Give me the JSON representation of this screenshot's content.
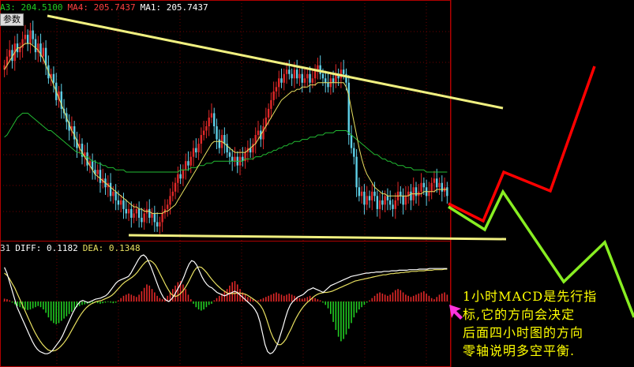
{
  "colors": {
    "background": "#000000",
    "frame": "#b00000",
    "grid": "#6e0000",
    "up_candle": "#e02828",
    "down_candle": "#5fd0e8",
    "ma_short": "#e8e060",
    "ma_long": "#22bb33",
    "trendline": "#f0f080",
    "diff_line": "#ffffff",
    "dea_line": "#e8e060",
    "macd_up": "#e02828",
    "macd_down": "#22cc22",
    "forecast_red": "#ff0000",
    "forecast_green": "#88ee22",
    "annotation_text": "#ffff00",
    "arrow": "#ff33dd"
  },
  "legend_top": [
    {
      "text": "A3: 204.5100",
      "color": "#22cc22"
    },
    {
      "text": "MA4: 205.7437",
      "color": "#ff4040"
    },
    {
      "text": "MA1: 205.7437",
      "color": "#ffffff"
    }
  ],
  "param_tag": "参数",
  "legend_bottom": [
    {
      "text": "31",
      "color": "#dddddd"
    },
    {
      "text": "DIFF: 0.1182",
      "color": "#ffffff"
    },
    {
      "text": "DEA: 0.1348",
      "color": "#e8e060"
    }
  ],
  "annotation": {
    "lines": [
      "1小时MACD是先行指",
      "标,它的方向会决定",
      "后面四小时图的方向",
      "零轴说明多空平衡."
    ]
  },
  "chart_data": {
    "type": "candlestick",
    "price": {
      "ylim": [
        0,
        100
      ],
      "closes": [
        78,
        82,
        85,
        80,
        88,
        84,
        86,
        90,
        92,
        88,
        94,
        90,
        84,
        88,
        82,
        86,
        78,
        72,
        74,
        70,
        62,
        66,
        58,
        56,
        52,
        48,
        50,
        44,
        40,
        42,
        36,
        38,
        32,
        34,
        30,
        28,
        30,
        24,
        26,
        22,
        24,
        18,
        20,
        16,
        14,
        16,
        12,
        10,
        12,
        8,
        10,
        12,
        8,
        6,
        10,
        12,
        8,
        10,
        6,
        4,
        6,
        10,
        12,
        14,
        18,
        20,
        24,
        28,
        26,
        30,
        34,
        32,
        36,
        40,
        38,
        42,
        46,
        48,
        50,
        54,
        56,
        50,
        44,
        40,
        46,
        42,
        38,
        36,
        34,
        36,
        32,
        36,
        34,
        38,
        40,
        38,
        42,
        46,
        48,
        44,
        50,
        54,
        58,
        62,
        66,
        68,
        72,
        70,
        74,
        76,
        74,
        72,
        76,
        72,
        74,
        70,
        72,
        74,
        70,
        72,
        76,
        78,
        74,
        72,
        70,
        68,
        72,
        70,
        74,
        72,
        76,
        74,
        70,
        46,
        40,
        36,
        22,
        18,
        20,
        14,
        18,
        16,
        20,
        18,
        12,
        16,
        14,
        18,
        16,
        14,
        12,
        16,
        20,
        18,
        14,
        18,
        20,
        16,
        22,
        18,
        20,
        24,
        22,
        18,
        20,
        24,
        26,
        22,
        24,
        20,
        22,
        18
      ],
      "ma_short": [
        76,
        78,
        80,
        82,
        84,
        86,
        86,
        87,
        88,
        88,
        88,
        87,
        86,
        85,
        83,
        81,
        78,
        75,
        72,
        69,
        66,
        63,
        60,
        57,
        54,
        51,
        48,
        46,
        43,
        40,
        38,
        36,
        34,
        32,
        30,
        28,
        27,
        26,
        25,
        24,
        23,
        22,
        21,
        20,
        19,
        18,
        17,
        16,
        15,
        14,
        13,
        13,
        12,
        12,
        11,
        11,
        11,
        10,
        10,
        10,
        10,
        10,
        11,
        11,
        12,
        13,
        14,
        16,
        18,
        20,
        22,
        24,
        26,
        28,
        30,
        32,
        34,
        36,
        38,
        40,
        42,
        43,
        43,
        43,
        43,
        42,
        41,
        40,
        39,
        38,
        38,
        38,
        38,
        38,
        39,
        40,
        41,
        42,
        44,
        46,
        48,
        50,
        52,
        54,
        56,
        58,
        60,
        62,
        63,
        64,
        65,
        66,
        66,
        67,
        67,
        68,
        68,
        68,
        69,
        69,
        69,
        70,
        70,
        70,
        70,
        70,
        70,
        70,
        70,
        70,
        70,
        70,
        68,
        64,
        58,
        52,
        46,
        40,
        35,
        31,
        28,
        26,
        24,
        22,
        21,
        20,
        19,
        19,
        18,
        18,
        18,
        18,
        18,
        18,
        18,
        18,
        18,
        19,
        19,
        19,
        19,
        19,
        20,
        20,
        20,
        20,
        20,
        21,
        21,
        21,
        21,
        21
      ],
      "ma_long": [
        45,
        46,
        48,
        50,
        52,
        54,
        55,
        56,
        56,
        56,
        55,
        54,
        53,
        52,
        51,
        50,
        49,
        48,
        48,
        47,
        46,
        45,
        44,
        43,
        42,
        41,
        40,
        39,
        38,
        38,
        37,
        36,
        36,
        35,
        34,
        34,
        33,
        33,
        32,
        32,
        31,
        31,
        31,
        30,
        30,
        30,
        30,
        29,
        29,
        29,
        29,
        29,
        29,
        29,
        29,
        29,
        29,
        29,
        29,
        29,
        29,
        29,
        29,
        29,
        29,
        29,
        29,
        29,
        30,
        30,
        30,
        30,
        31,
        31,
        31,
        32,
        32,
        32,
        33,
        33,
        33,
        34,
        34,
        34,
        34,
        34,
        34,
        34,
        34,
        34,
        34,
        34,
        34,
        35,
        35,
        35,
        35,
        36,
        36,
        36,
        37,
        37,
        38,
        38,
        39,
        39,
        40,
        40,
        41,
        41,
        42,
        42,
        43,
        43,
        43,
        44,
        44,
        44,
        45,
        45,
        45,
        46,
        46,
        46,
        47,
        47,
        47,
        47,
        48,
        48,
        48,
        48,
        48,
        47,
        46,
        45,
        44,
        43,
        42,
        41,
        40,
        39,
        38,
        37,
        37,
        36,
        35,
        35,
        34,
        34,
        33,
        33,
        32,
        32,
        32,
        31,
        31,
        31,
        30,
        30,
        30,
        30,
        30,
        29,
        29,
        29,
        29,
        29,
        29,
        29,
        29,
        29
      ]
    },
    "macd": {
      "ylim": [
        -1,
        1
      ],
      "hist": [
        0.05,
        0.04,
        0.02,
        -0.02,
        -0.05,
        -0.08,
        -0.1,
        -0.12,
        -0.14,
        -0.15,
        -0.14,
        -0.12,
        -0.1,
        -0.08,
        -0.1,
        -0.14,
        -0.2,
        -0.28,
        -0.34,
        -0.38,
        -0.4,
        -0.38,
        -0.34,
        -0.3,
        -0.26,
        -0.22,
        -0.18,
        -0.14,
        -0.1,
        -0.08,
        -0.06,
        -0.05,
        -0.04,
        -0.03,
        -0.02,
        -0.02,
        -0.03,
        -0.04,
        -0.03,
        -0.02,
        -0.01,
        -0.02,
        -0.03,
        -0.02,
        0.02,
        0.06,
        0.1,
        0.12,
        0.14,
        0.12,
        0.1,
        0.08,
        0.12,
        0.18,
        0.24,
        0.3,
        0.28,
        0.22,
        0.16,
        0.1,
        0.06,
        0.04,
        0.06,
        0.1,
        0.16,
        0.22,
        0.28,
        0.34,
        0.36,
        0.3,
        0.22,
        0.12,
        0.04,
        -0.04,
        -0.1,
        -0.14,
        -0.16,
        -0.14,
        -0.1,
        -0.06,
        -0.04,
        0.02,
        0.06,
        0.1,
        0.14,
        0.18,
        0.22,
        0.28,
        0.34,
        0.36,
        0.3,
        0.22,
        0.16,
        0.12,
        0.08,
        0.06,
        0.04,
        0.02,
        0.02,
        0.04,
        0.06,
        0.08,
        0.1,
        0.12,
        0.14,
        0.16,
        0.14,
        0.12,
        0.1,
        0.12,
        0.14,
        0.12,
        0.1,
        0.08,
        0.06,
        0.05,
        0.06,
        0.08,
        0.1,
        0.08,
        0.06,
        0.04,
        0.02,
        -0.02,
        -0.06,
        -0.12,
        -0.22,
        -0.36,
        -0.5,
        -0.62,
        -0.7,
        -0.66,
        -0.58,
        -0.48,
        -0.38,
        -0.28,
        -0.2,
        -0.14,
        -0.1,
        -0.06,
        -0.02,
        0.02,
        0.06,
        0.1,
        0.14,
        0.16,
        0.14,
        0.12,
        0.1,
        0.12,
        0.16,
        0.2,
        0.22,
        0.2,
        0.16,
        0.12,
        0.1,
        0.08,
        0.1,
        0.12,
        0.14,
        0.16,
        0.18,
        0.14,
        0.1,
        0.06,
        0.04,
        0.08,
        0.12,
        0.14,
        0.16,
        0.12
      ],
      "diff": [
        0.6,
        0.5,
        0.35,
        0.2,
        0.05,
        -0.1,
        -0.2,
        -0.3,
        -0.4,
        -0.5,
        -0.6,
        -0.7,
        -0.78,
        -0.84,
        -0.88,
        -0.9,
        -0.92,
        -0.92,
        -0.9,
        -0.86,
        -0.8,
        -0.74,
        -0.68,
        -0.6,
        -0.5,
        -0.4,
        -0.3,
        -0.2,
        -0.12,
        -0.05,
        0.0,
        0.02,
        0.0,
        -0.02,
        0.0,
        0.02,
        0.04,
        0.05,
        0.06,
        0.08,
        0.1,
        0.14,
        0.2,
        0.26,
        0.32,
        0.36,
        0.38,
        0.4,
        0.42,
        0.44,
        0.5,
        0.58,
        0.66,
        0.74,
        0.8,
        0.82,
        0.78,
        0.7,
        0.6,
        0.48,
        0.36,
        0.24,
        0.14,
        0.06,
        0.02,
        0.0,
        0.04,
        0.1,
        0.18,
        0.26,
        0.34,
        0.44,
        0.56,
        0.66,
        0.72,
        0.7,
        0.64,
        0.54,
        0.44,
        0.36,
        0.3,
        0.26,
        0.24,
        0.2,
        0.16,
        0.14,
        0.12,
        0.1,
        0.12,
        0.14,
        0.16,
        0.18,
        0.16,
        0.12,
        0.08,
        0.04,
        0.0,
        -0.04,
        -0.08,
        -0.14,
        -0.22,
        -0.36,
        -0.56,
        -0.76,
        -0.88,
        -0.92,
        -0.9,
        -0.84,
        -0.74,
        -0.6,
        -0.46,
        -0.3,
        -0.16,
        -0.06,
        0.0,
        0.04,
        0.08,
        0.1,
        0.12,
        0.16,
        0.2,
        0.22,
        0.24,
        0.22,
        0.2,
        0.18,
        0.16,
        0.2,
        0.24,
        0.28,
        0.3,
        0.32,
        0.34,
        0.36,
        0.38,
        0.4,
        0.42,
        0.44,
        0.45,
        0.46,
        0.47,
        0.48,
        0.49,
        0.5,
        0.5,
        0.51,
        0.51,
        0.52,
        0.52,
        0.52,
        0.53,
        0.53,
        0.53,
        0.54,
        0.54,
        0.54,
        0.55,
        0.55,
        0.55,
        0.55,
        0.56,
        0.56,
        0.56,
        0.56,
        0.57,
        0.57,
        0.57,
        0.57,
        0.58,
        0.58,
        0.58,
        0.58,
        0.58,
        0.58,
        0.58,
        0.58
      ],
      "dea": [
        0.5,
        0.46,
        0.4,
        0.32,
        0.24,
        0.14,
        0.04,
        -0.06,
        -0.16,
        -0.26,
        -0.36,
        -0.46,
        -0.55,
        -0.63,
        -0.7,
        -0.76,
        -0.81,
        -0.85,
        -0.87,
        -0.87,
        -0.86,
        -0.83,
        -0.79,
        -0.74,
        -0.68,
        -0.61,
        -0.53,
        -0.45,
        -0.37,
        -0.29,
        -0.22,
        -0.16,
        -0.11,
        -0.07,
        -0.04,
        -0.02,
        0.0,
        0.01,
        0.02,
        0.04,
        0.06,
        0.08,
        0.11,
        0.15,
        0.2,
        0.25,
        0.3,
        0.34,
        0.37,
        0.4,
        0.43,
        0.47,
        0.52,
        0.58,
        0.64,
        0.69,
        0.72,
        0.72,
        0.69,
        0.64,
        0.56,
        0.47,
        0.38,
        0.29,
        0.21,
        0.14,
        0.1,
        0.09,
        0.11,
        0.15,
        0.2,
        0.27,
        0.35,
        0.44,
        0.53,
        0.59,
        0.61,
        0.6,
        0.56,
        0.51,
        0.45,
        0.39,
        0.34,
        0.29,
        0.25,
        0.21,
        0.18,
        0.15,
        0.14,
        0.14,
        0.14,
        0.15,
        0.15,
        0.14,
        0.13,
        0.11,
        0.08,
        0.05,
        0.02,
        -0.02,
        -0.07,
        -0.14,
        -0.25,
        -0.39,
        -0.53,
        -0.64,
        -0.72,
        -0.76,
        -0.76,
        -0.72,
        -0.66,
        -0.57,
        -0.48,
        -0.38,
        -0.29,
        -0.21,
        -0.14,
        -0.08,
        -0.03,
        0.01,
        0.05,
        0.09,
        0.12,
        0.14,
        0.15,
        0.16,
        0.16,
        0.17,
        0.18,
        0.2,
        0.22,
        0.24,
        0.26,
        0.28,
        0.3,
        0.32,
        0.34,
        0.36,
        0.37,
        0.38,
        0.39,
        0.4,
        0.41,
        0.42,
        0.43,
        0.44,
        0.45,
        0.46,
        0.47,
        0.47,
        0.48,
        0.49,
        0.49,
        0.5,
        0.5,
        0.51,
        0.51,
        0.52,
        0.52,
        0.53,
        0.53,
        0.53,
        0.54,
        0.54,
        0.54,
        0.55,
        0.55,
        0.55,
        0.56,
        0.56,
        0.56,
        0.56,
        0.57,
        0.57
      ]
    }
  }
}
